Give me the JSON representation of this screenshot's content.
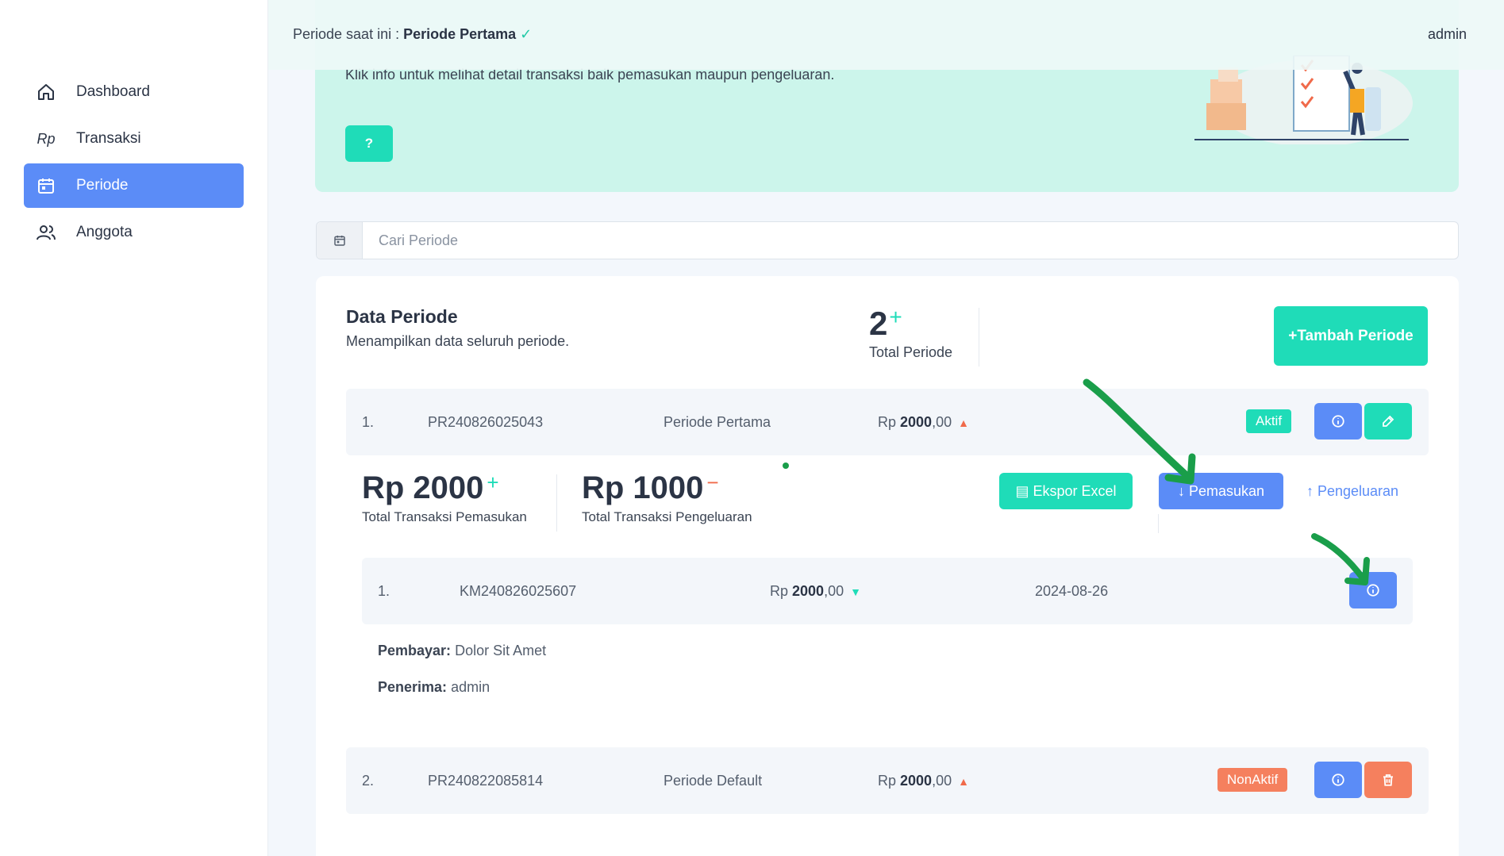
{
  "topbar": {
    "periode_prefix": "Periode saat ini : ",
    "periode_name": "Periode Pertama",
    "user": "admin"
  },
  "sidebar": {
    "items": [
      {
        "label": "Dashboard",
        "icon": "home-icon"
      },
      {
        "label": "Transaksi",
        "icon": "rupiah-icon",
        "icon_text": "Rp"
      },
      {
        "label": "Periode",
        "icon": "calendar-icon",
        "active": true
      },
      {
        "label": "Anggota",
        "icon": "users-icon"
      }
    ]
  },
  "banner": {
    "description": "Klik info untuk melihat detail transaksi baik pemasukan maupun pengeluaran.",
    "help_label": "?"
  },
  "search": {
    "placeholder": "Cari Periode"
  },
  "card": {
    "title": "Data Periode",
    "subtitle": "Menampilkan data seluruh periode.",
    "total_count": "2",
    "total_plus": "+",
    "total_label": "Total Periode",
    "add_button": "+Tambah Periode"
  },
  "periods": [
    {
      "index": "1.",
      "code": "PR240826025043",
      "name": "Periode Pertama",
      "currency": "Rp ",
      "amount": "2000",
      "decimals": ",00",
      "status": "Aktif"
    },
    {
      "index": "2.",
      "code": "PR240822085814",
      "name": "Periode Default",
      "currency": "Rp ",
      "amount": "2000",
      "decimals": ",00",
      "status": "NonAktif"
    }
  ],
  "detail": {
    "pemasukan_amount": "Rp 2000",
    "pemasukan_sign": "+",
    "pemasukan_label": "Total Transaksi Pemasukan",
    "pengeluaran_amount": "Rp 1000",
    "pengeluaran_sign": "−",
    "pengeluaran_label": "Total Transaksi Pengeluaran",
    "export_label": "Ekspor Excel",
    "pemasukan_tab": "Pemasukan",
    "pengeluaran_tab": "Pengeluaran",
    "transaction": {
      "index": "1.",
      "code": "KM240826025607",
      "currency": "Rp ",
      "amount": "2000",
      "decimals": ",00",
      "date": "2024-08-26"
    },
    "pembayar_label": "Pembayar:",
    "pembayar_value": "Dolor Sit Amet",
    "penerima_label": "Penerima:",
    "penerima_value": "admin"
  },
  "colors": {
    "primary_blue": "#5b8cf7",
    "teal": "#1fdcb8",
    "orange": "#f5805e",
    "banner_bg": "#ccf5eb",
    "annotation_arrow": "#1a9e4a"
  }
}
